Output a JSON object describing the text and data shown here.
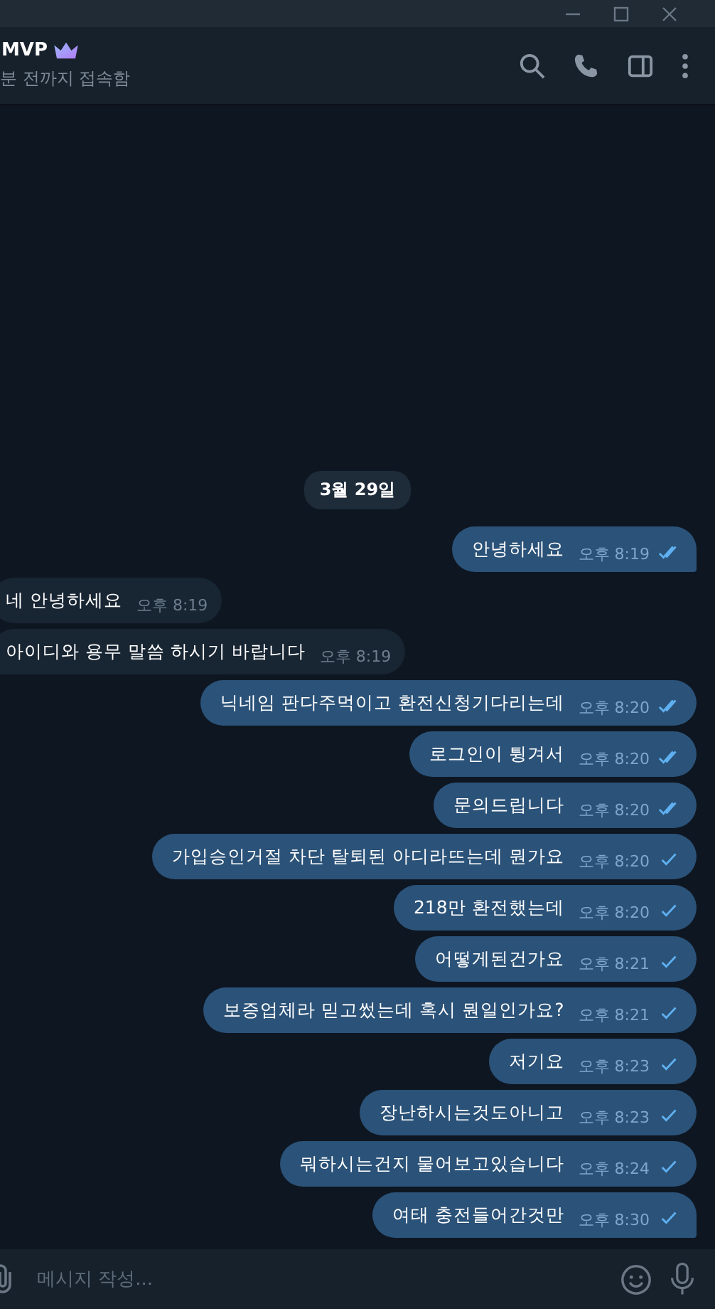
{
  "chat": {
    "name": "MVP",
    "status": "분 전까지 접속함"
  },
  "date_label": "3월 29일",
  "messages": [
    {
      "kind": "outgoing",
      "text": "안녕하세요",
      "time": "오후 8:19",
      "read": true
    },
    {
      "kind": "incoming",
      "text": "네 안녕하세요",
      "time": "오후 8:19"
    },
    {
      "kind": "incoming",
      "text": "아이디와 용무 말씀 하시기 바랍니다",
      "time": "오후 8:19"
    },
    {
      "kind": "outgoing",
      "text": "닉네임 판다주먹이고 환전신청기다리는데",
      "time": "오후 8:20",
      "read": true
    },
    {
      "kind": "outgoing",
      "text": "로그인이 튕겨서",
      "time": "오후 8:20",
      "read": true
    },
    {
      "kind": "outgoing",
      "text": "문의드립니다",
      "time": "오후 8:20",
      "read": true
    },
    {
      "kind": "outgoing",
      "text": "가입승인거절 차단 탈퇴된 아디라뜨는데 뭔가요",
      "time": "오후 8:20",
      "read": false
    },
    {
      "kind": "outgoing",
      "text": "218만 환전했는데",
      "time": "오후 8:20",
      "read": false
    },
    {
      "kind": "outgoing",
      "text": "어떻게된건가요",
      "time": "오후 8:21",
      "read": false
    },
    {
      "kind": "outgoing",
      "text": "보증업체라 믿고썼는데 혹시 뭔일인가요?",
      "time": "오후 8:21",
      "read": false
    },
    {
      "kind": "outgoing",
      "text": "저기요",
      "time": "오후 8:23",
      "read": false
    },
    {
      "kind": "outgoing",
      "text": "장난하시는것도아니고",
      "time": "오후 8:23",
      "read": false
    },
    {
      "kind": "outgoing",
      "text": "뭐하시는건지 물어보고있습니다",
      "time": "오후 8:24",
      "read": false
    },
    {
      "kind": "outgoing",
      "text": "여태 충전들어간것만",
      "time": "오후 8:30",
      "read": false
    }
  ],
  "composer": {
    "placeholder": "메시지 작성..."
  }
}
